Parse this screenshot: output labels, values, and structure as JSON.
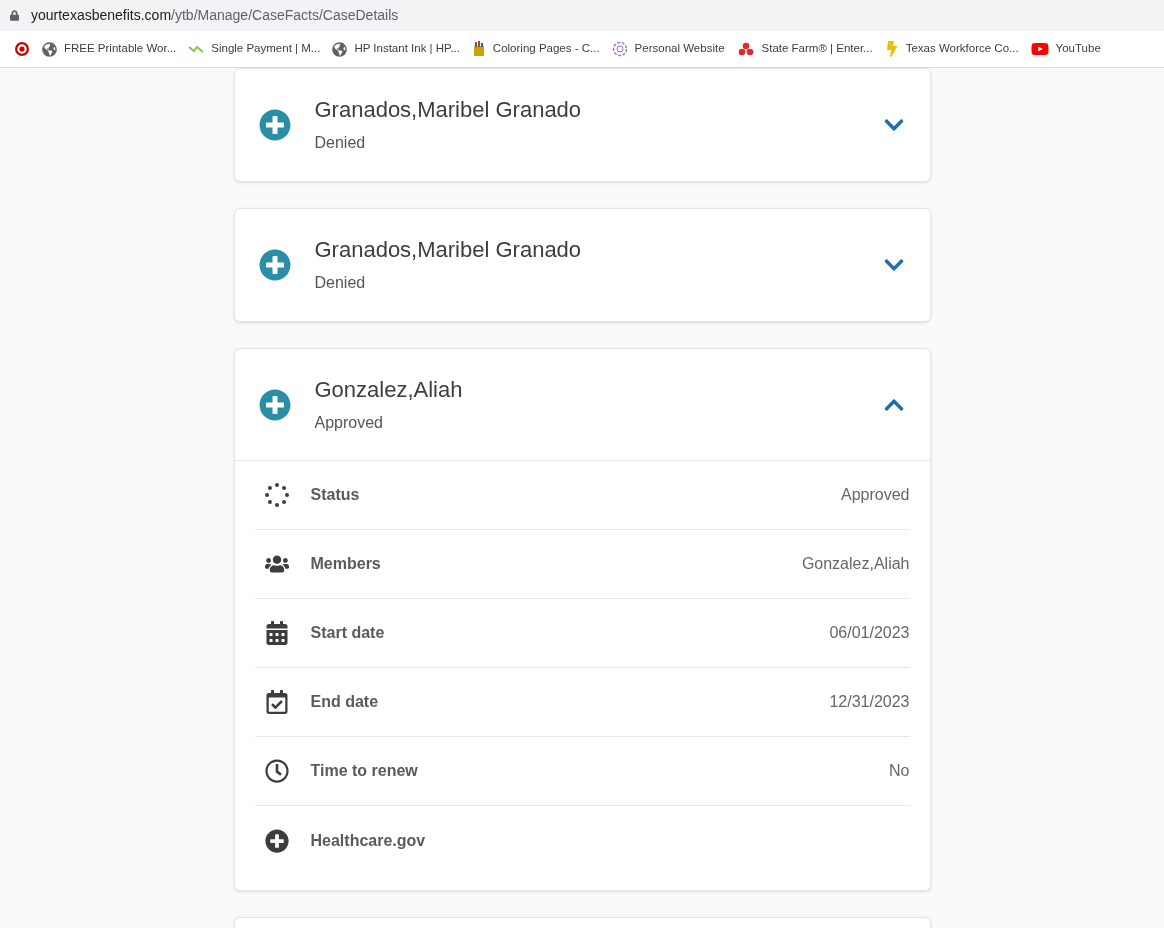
{
  "browser": {
    "address": {
      "host": "yourtexasbenefits.com",
      "path": "/ytb/Manage/CaseFacts/CaseDetails"
    },
    "bookmarks": [
      {
        "kind": "target"
      },
      {
        "kind": "globe",
        "label": "FREE Printable Wor..."
      },
      {
        "kind": "zigzag",
        "label": "Single Payment | M..."
      },
      {
        "kind": "globe",
        "label": "HP Instant Ink | HP..."
      },
      {
        "kind": "bucket",
        "label": "Coloring Pages - C..."
      },
      {
        "kind": "flower",
        "label": "Personal Website"
      },
      {
        "kind": "cubes",
        "label": "State Farm® | Enter..."
      },
      {
        "kind": "bolt",
        "label": "Texas Workforce Co..."
      },
      {
        "kind": "youtube",
        "label": "YouTube"
      }
    ]
  },
  "cases": [
    {
      "name": "Granados,Maribel Granado",
      "status": "Denied",
      "expanded": false
    },
    {
      "name": "Granados,Maribel Granado",
      "status": "Denied",
      "expanded": false
    },
    {
      "name": "Gonzalez,Aliah",
      "status": "Approved",
      "expanded": true,
      "details": [
        {
          "kind": "status",
          "label": "Status",
          "value": "Approved"
        },
        {
          "kind": "members",
          "label": "Members",
          "value": "Gonzalez,Aliah"
        },
        {
          "kind": "start",
          "label": "Start date",
          "value": "06/01/2023"
        },
        {
          "kind": "end",
          "label": "End date",
          "value": "12/31/2023"
        },
        {
          "kind": "renew",
          "label": "Time to renew",
          "value": "No"
        },
        {
          "kind": "link",
          "label": "Healthcare.gov"
        }
      ]
    }
  ]
}
